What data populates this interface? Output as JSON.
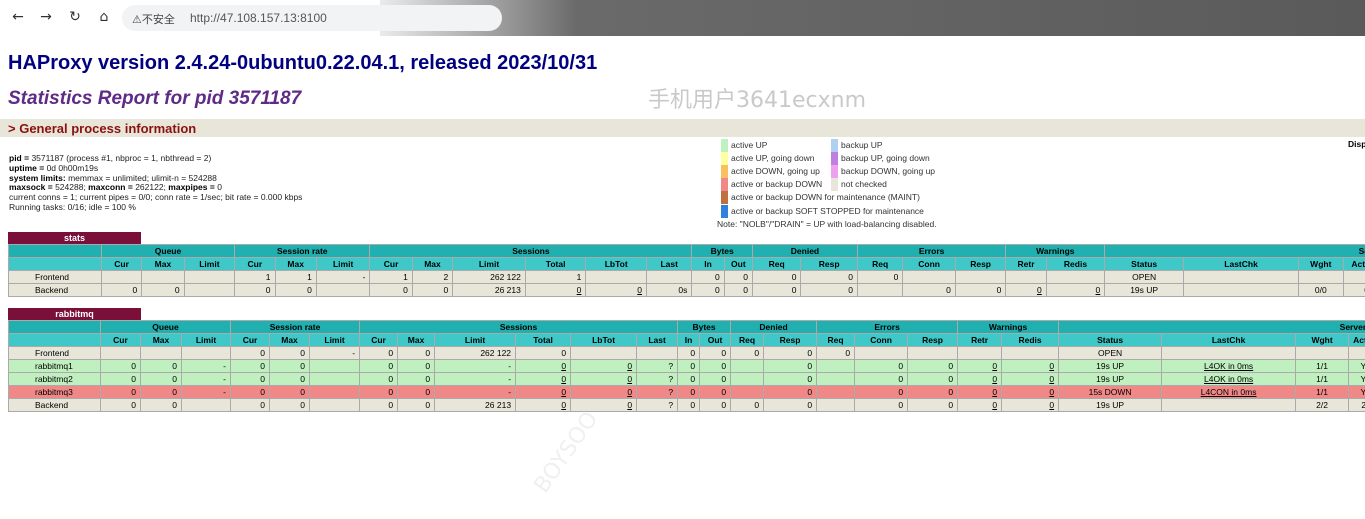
{
  "browser": {
    "insecure_label": "不安全",
    "url": "http://47.108.157.13:8100"
  },
  "title": "HAProxy version 2.4.24-0ubuntu0.22.04.1, released 2023/10/31",
  "subtitle": "Statistics Report for pid 3571187",
  "watermark": "手机用户3641ecxnm",
  "watermark2": "BOYSOO",
  "section": "> General process information",
  "process_info": [
    {
      "bold": "pid = ",
      "rest": "3571187 (process #1, nbproc = 1, nbthread = 2)"
    },
    {
      "bold": "uptime = ",
      "rest": "0d 0h00m19s"
    },
    {
      "bold": "system limits: ",
      "rest": "memmax = unlimited; ulimit-n = 524288"
    },
    {
      "bold": "maxsock = ",
      "rest": "524288; ",
      "bold2": "maxconn = ",
      "rest2": "262122; ",
      "bold3": "maxpipes = ",
      "rest3": "0"
    },
    {
      "bold": "",
      "rest": "current conns = 1; current pipes = 0/0; conn rate = 1/sec; bit rate = 0.000 kbps"
    },
    {
      "bold": "",
      "rest": "Running tasks: 0/16; idle = 100 %"
    }
  ],
  "legend": {
    "left": [
      {
        "label": "active UP",
        "color": "#c0f0c0"
      },
      {
        "label": "active UP, going down",
        "color": "#ffffa0"
      },
      {
        "label": "active DOWN, going up",
        "color": "#f8c060"
      },
      {
        "label": "active or backup DOWN",
        "color": "#f08888"
      },
      {
        "label": "active or backup DOWN for maintenance (MAINT)",
        "color": "#c07040"
      },
      {
        "label": "active or backup SOFT STOPPED for maintenance",
        "color": "#3080e0"
      }
    ],
    "right": [
      {
        "label": "backup UP",
        "color": "#b0d0f0"
      },
      {
        "label": "backup UP, going down",
        "color": "#c080e0"
      },
      {
        "label": "backup DOWN, going up",
        "color": "#f0a0f0"
      },
      {
        "label": "not checked",
        "color": "#e8e6d8"
      }
    ],
    "note": "Note: \"NOLB\"/\"DRAIN\" = UP with load-balancing disabled.",
    "disp": "Disp"
  },
  "headers": {
    "groups": [
      "Queue",
      "Session rate",
      "Sessions",
      "Bytes",
      "Denied",
      "Errors",
      "Warnings",
      "Server"
    ],
    "sub": [
      "Cur",
      "Max",
      "Limit",
      "Cur",
      "Max",
      "Limit",
      "Cur",
      "Max",
      "Limit",
      "Total",
      "LbTot",
      "Last",
      "In",
      "Out",
      "Req",
      "Resp",
      "Req",
      "Conn",
      "Resp",
      "Retr",
      "Redis",
      "Status",
      "LastChk",
      "Wght",
      "Act"
    ]
  },
  "stats": {
    "name": "stats",
    "server_label": "Se",
    "rows": [
      {
        "name": "Frontend",
        "cells": [
          "",
          "",
          "",
          "1",
          "1",
          "-",
          "1",
          "2",
          "262 122",
          "1",
          "",
          "",
          "0",
          "0",
          "0",
          "0",
          "0",
          "",
          "",
          "",
          "",
          "OPEN",
          "",
          "",
          ""
        ]
      },
      {
        "name": "Backend",
        "cells": [
          "0",
          "0",
          "",
          "0",
          "0",
          "",
          "0",
          "0",
          "26 213",
          "0",
          "0",
          "0s",
          "0",
          "0",
          "0",
          "0",
          "",
          "0",
          "0",
          "0",
          "0",
          "19s UP",
          "",
          "0/0",
          "0"
        ]
      }
    ]
  },
  "rabbitmq": {
    "name": "rabbitmq",
    "rows": [
      {
        "name": "Frontend",
        "cells": [
          "",
          "",
          "",
          "0",
          "0",
          "-",
          "0",
          "0",
          "262 122",
          "0",
          "",
          "",
          "0",
          "0",
          "0",
          "0",
          "0",
          "",
          "",
          "",
          "",
          "OPEN",
          "",
          "",
          ""
        ]
      },
      {
        "name": "rabbitmq1",
        "cells": [
          "0",
          "0",
          "-",
          "0",
          "0",
          "",
          "0",
          "0",
          "-",
          "0",
          "0",
          "?",
          "0",
          "0",
          "",
          "0",
          "",
          "0",
          "0",
          "0",
          "0",
          "19s UP",
          "L4OK in 0ms",
          "1/1",
          "Y"
        ]
      },
      {
        "name": "rabbitmq2",
        "cells": [
          "0",
          "0",
          "-",
          "0",
          "0",
          "",
          "0",
          "0",
          "-",
          "0",
          "0",
          "?",
          "0",
          "0",
          "",
          "0",
          "",
          "0",
          "0",
          "0",
          "0",
          "19s UP",
          "L4OK in 0ms",
          "1/1",
          "Y"
        ]
      },
      {
        "name": "rabbitmq3",
        "cells": [
          "0",
          "0",
          "-",
          "0",
          "0",
          "",
          "0",
          "0",
          "-",
          "0",
          "0",
          "?",
          "0",
          "0",
          "",
          "0",
          "",
          "0",
          "0",
          "0",
          "0",
          "15s DOWN",
          "L4CON in 0ms",
          "1/1",
          "Y"
        ]
      },
      {
        "name": "Backend",
        "cells": [
          "0",
          "0",
          "",
          "0",
          "0",
          "",
          "0",
          "0",
          "26 213",
          "0",
          "0",
          "?",
          "0",
          "0",
          "0",
          "0",
          "",
          "0",
          "0",
          "0",
          "0",
          "19s UP",
          "",
          "2/2",
          "2"
        ]
      }
    ]
  }
}
